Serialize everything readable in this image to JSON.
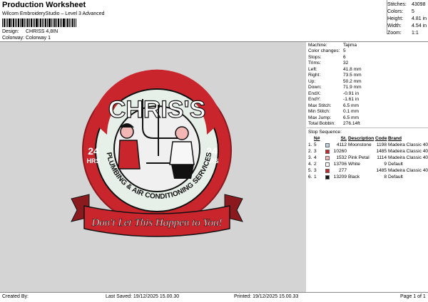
{
  "header": {
    "title": "Production Worksheet",
    "software": "Wilcom EmbroideryStudio – Level 3 Advanced",
    "design_label": "Design:",
    "design_value": "CHRISS 4,8IN",
    "colorway_label": "Colorway:",
    "colorway_value": "Colorway 1"
  },
  "stats": [
    {
      "label": "Stitches:",
      "value": "43098"
    },
    {
      "label": "Colors:",
      "value": "5"
    },
    {
      "label": "Height:",
      "value": "4.81 in"
    },
    {
      "label": "Width:",
      "value": "4.54 in"
    },
    {
      "label": "Zoom:",
      "value": "1:1"
    }
  ],
  "logo": {
    "name": "CHRIS'S",
    "hours_left": "24",
    "hrs_left": "HRS",
    "hours_right": "24",
    "hrs_right": "HRS",
    "services": "PLUMBING & AIR CONDITIONING SERVICES",
    "banner": "Don't Let This Happen to You!"
  },
  "info": [
    {
      "label": "Machine:",
      "value": "Tajima"
    },
    {
      "label": "Color changes:",
      "value": "5"
    },
    {
      "label": "Stops:",
      "value": "6"
    },
    {
      "label": "Trims:",
      "value": "32"
    },
    {
      "label": "Left:",
      "value": "41.8 mm"
    },
    {
      "label": "Right:",
      "value": "73.5 mm"
    },
    {
      "label": "Up:",
      "value": "50.2 mm"
    },
    {
      "label": "Down:",
      "value": "71.9 mm"
    },
    {
      "label": "EndX:",
      "value": "-0.91 in"
    },
    {
      "label": "EndY:",
      "value": "-1.61 in"
    },
    {
      "label": "Max Stitch:",
      "value": "6.5 mm"
    },
    {
      "label": "Min Stitch:",
      "value": "0.1 mm"
    },
    {
      "label": "Max Jump:",
      "value": "6.5 mm"
    },
    {
      "label": "Total Bobbin:",
      "value": "276.14ft"
    }
  ],
  "stop_sequence": {
    "title": "Stop Sequence:",
    "headers": {
      "n": "N#",
      "st": "St.",
      "desc": "Description",
      "code": "Code",
      "brand": "Brand"
    },
    "rows": [
      {
        "idx": "1.",
        "n": "5",
        "color": "#b9cfe6",
        "st": "4112",
        "desc": "Moonstone",
        "code": "1198",
        "brand": "Madeira Classic 40"
      },
      {
        "idx": "2.",
        "n": "3",
        "color": "#c8262c",
        "st": "10260",
        "desc": "",
        "code": "1485",
        "brand": "Madeira Classic 40"
      },
      {
        "idx": "3.",
        "n": "4",
        "color": "#f2b6b4",
        "st": "1532",
        "desc": "Pink Petal",
        "code": "1114",
        "brand": "Madeira Classic 40"
      },
      {
        "idx": "4.",
        "n": "2",
        "color": "#ffffff",
        "st": "13706",
        "desc": "White",
        "code": "9",
        "brand": "Default"
      },
      {
        "idx": "5.",
        "n": "3",
        "color": "#c8262c",
        "st": "277",
        "desc": "",
        "code": "1485",
        "brand": "Madeira Classic 40"
      },
      {
        "idx": "6.",
        "n": "1",
        "color": "#111111",
        "st": "13209",
        "desc": "Black",
        "code": "8",
        "brand": "Default"
      }
    ]
  },
  "footer": {
    "created": "Created By:",
    "saved": "Last Saved: 19/12/2025 15.00.30",
    "printed": "Printed: 19/12/2025 15.00.33",
    "page": "Page 1 of 1"
  },
  "colors": {
    "red": "#c8262c",
    "canvas": "#d4d4d4",
    "mint": "#e6efe8",
    "black": "#111111"
  }
}
